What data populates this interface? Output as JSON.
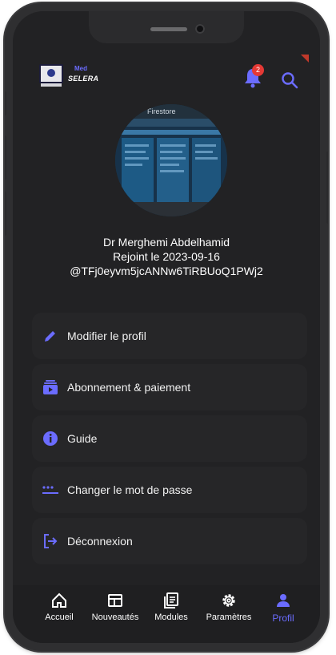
{
  "app": {
    "logo_badge": "Med",
    "logo_name": "SELERA",
    "notification_count": "2",
    "accent_color": "#6b6cff"
  },
  "profile": {
    "name": "Dr Merghemi Abdelhamid",
    "joined": "Rejoint le 2023-09-16",
    "user_id": "@TFj0eyvm5jcANNw6TiRBUoQ1PWj2",
    "avatar_caption": "Firestore"
  },
  "menu": [
    {
      "label": "Modifier le profil",
      "icon": "pencil-icon"
    },
    {
      "label": "Abonnement & paiement",
      "icon": "subscription-icon"
    },
    {
      "label": "Guide",
      "icon": "info-icon"
    },
    {
      "label": "Changer le mot de passe",
      "icon": "password-icon"
    },
    {
      "label": "Déconnexion",
      "icon": "logout-icon"
    }
  ],
  "nav": [
    {
      "label": "Accueil",
      "icon": "home-icon",
      "active": false
    },
    {
      "label": "Nouveautés",
      "icon": "news-icon",
      "active": false
    },
    {
      "label": "Modules",
      "icon": "modules-icon",
      "active": false
    },
    {
      "label": "Paramètres",
      "icon": "gear-icon",
      "active": false
    },
    {
      "label": "Profil",
      "icon": "person-icon",
      "active": true
    }
  ]
}
